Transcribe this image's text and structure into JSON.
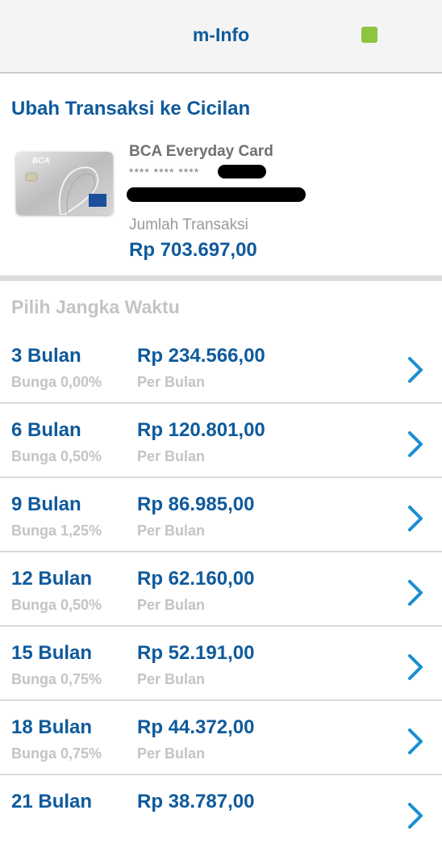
{
  "header": {
    "title": "m-Info",
    "status_color": "#8cc63f"
  },
  "section_title": "Ubah Transaksi ke Cicilan",
  "card": {
    "name": "BCA Everyday Card",
    "number_masked": "**** **** ****",
    "brand_text": "BCA",
    "amount_label": "Jumlah Transaksi",
    "amount_value": "Rp 703.697,00"
  },
  "installments": {
    "title": "Pilih Jangka Waktu",
    "options": [
      {
        "term": "3 Bulan",
        "rate": "Bunga 0,00%",
        "amount": "Rp 234.566,00",
        "per": "Per Bulan"
      },
      {
        "term": "6 Bulan",
        "rate": "Bunga 0,50%",
        "amount": "Rp 120.801,00",
        "per": "Per Bulan"
      },
      {
        "term": "9 Bulan",
        "rate": "Bunga 1,25%",
        "amount": "Rp 86.985,00",
        "per": "Per Bulan"
      },
      {
        "term": "12 Bulan",
        "rate": "Bunga 0,50%",
        "amount": "Rp 62.160,00",
        "per": "Per Bulan"
      },
      {
        "term": "15 Bulan",
        "rate": "Bunga 0,75%",
        "amount": "Rp 52.191,00",
        "per": "Per Bulan"
      },
      {
        "term": "18 Bulan",
        "rate": "Bunga 0,75%",
        "amount": "Rp 44.372,00",
        "per": "Per Bulan"
      },
      {
        "term": "21 Bulan",
        "rate": "",
        "amount": "Rp 38.787,00",
        "per": ""
      }
    ]
  },
  "colors": {
    "accent": "#0f5a9c",
    "chevron": "#1a8fd1",
    "muted": "#c4c4c4"
  },
  "icons": {
    "row_action": "chevron-right-icon"
  }
}
